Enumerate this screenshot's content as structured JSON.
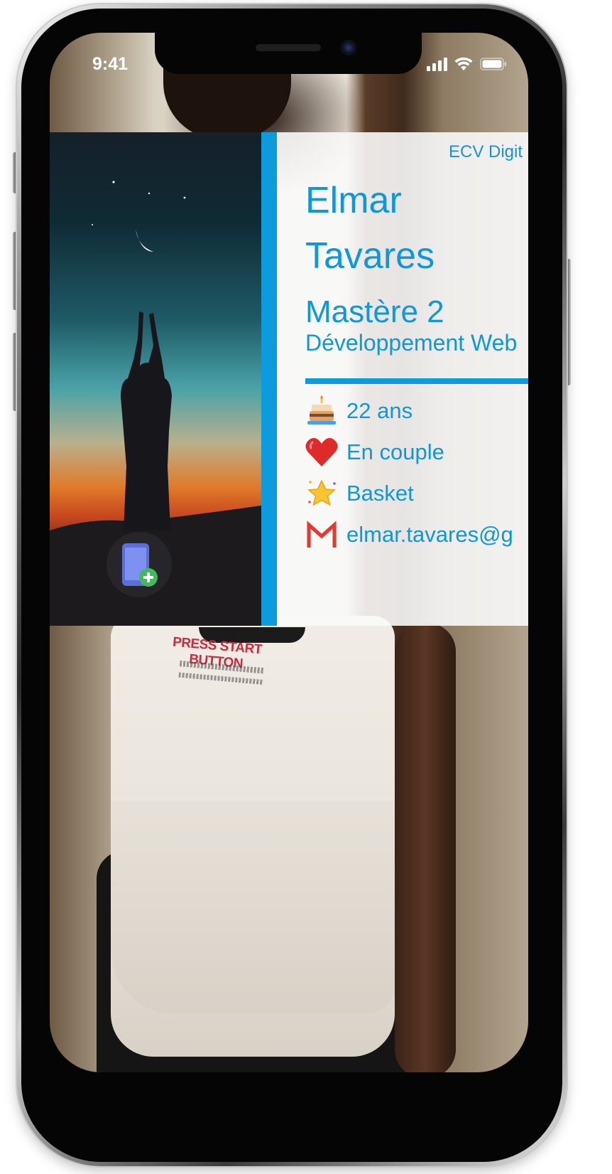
{
  "status_bar": {
    "time": "9:41"
  },
  "card": {
    "school": "ECV Digit",
    "first_name": "Elmar",
    "last_name": "Tavares",
    "degree": "Mastère 2",
    "program": "Développement Web",
    "accent_color": "#0d9be0",
    "text_color": "#0f97dc",
    "details": {
      "age": "22 ans",
      "relationship": "En couple",
      "hobby": "Basket",
      "email": "elmar.tavares@g"
    },
    "icons": {
      "age": "birthday-cake-icon",
      "relationship": "heart-icon",
      "hobby": "star-icon",
      "email": "gmail-icon",
      "add_contact": "add-phone-contact-icon"
    }
  },
  "background": {
    "shirt_print": "PRESS START BUTTON"
  }
}
